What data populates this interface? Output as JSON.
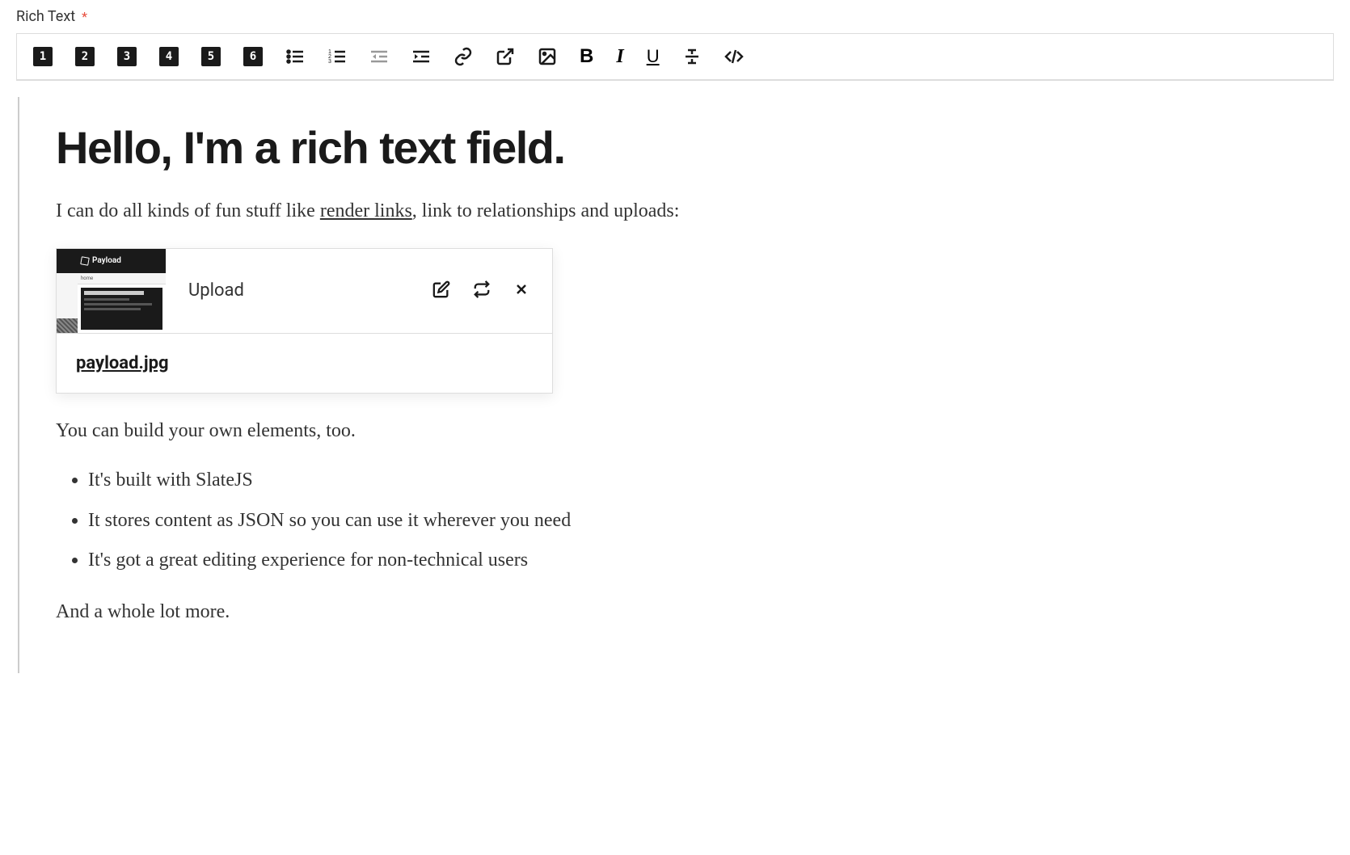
{
  "field": {
    "label": "Rich Text",
    "required_marker": "*"
  },
  "toolbar": {
    "h1": "1",
    "h2": "2",
    "h3": "3",
    "h4": "4",
    "h5": "5",
    "h6": "6",
    "bold_glyph": "B",
    "italic_glyph": "I",
    "underline_glyph": "U",
    "strike_glyph": "­"
  },
  "content": {
    "heading": "Hello, I'm a rich text field.",
    "p1_prefix": "I can do all kinds of fun stuff like ",
    "p1_link": "render links",
    "p1_suffix": ", link to relationships and uploads:",
    "upload": {
      "label": "Upload",
      "filename": "payload.jpg",
      "thumb_logo": "Payload"
    },
    "p2": "You can build your own elements, too.",
    "list": [
      "It's built with SlateJS",
      "It stores content as JSON so you can use it wherever you need",
      "It's got a great editing experience for non-technical users"
    ],
    "p3": "And a whole lot more."
  }
}
